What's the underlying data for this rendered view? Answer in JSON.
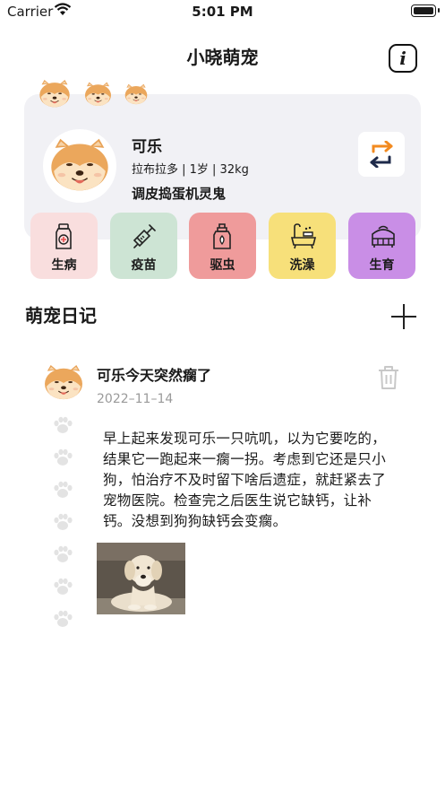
{
  "status_bar": {
    "carrier": "Carrier",
    "time": "5:01 PM"
  },
  "nav": {
    "title": "小晓萌宠",
    "info_icon": "info-icon"
  },
  "pet": {
    "name": "可乐",
    "info": "拉布拉多 | 1岁 | 32kg",
    "tagline": "调皮捣蛋机灵鬼"
  },
  "categories": [
    {
      "label": "生病",
      "icon": "medicine-bottle-icon",
      "color": "#f9dede"
    },
    {
      "label": "疫苗",
      "icon": "syringe-icon",
      "color": "#cde4d4"
    },
    {
      "label": "驱虫",
      "icon": "spray-bottle-icon",
      "color": "#ef9b9b"
    },
    {
      "label": "洗澡",
      "icon": "bathtub-icon",
      "color": "#f7e07a"
    },
    {
      "label": "生育",
      "icon": "pet-carrier-icon",
      "color": "#c98ee6"
    }
  ],
  "diary": {
    "title": "萌宠日记",
    "entry": {
      "title": "可乐今天突然瘸了",
      "date": "2022–11–14",
      "text": "早上起来发现可乐一只吭叽，以为它要吃的，结果它一跑起来一瘸一拐。考虑到它还是只小狗，怕治疗不及时留下啥后遗症，就赶紧去了宠物医院。检查完之后医生说它缺钙，让补钙。没想到狗狗缺钙会变瘸。"
    }
  }
}
